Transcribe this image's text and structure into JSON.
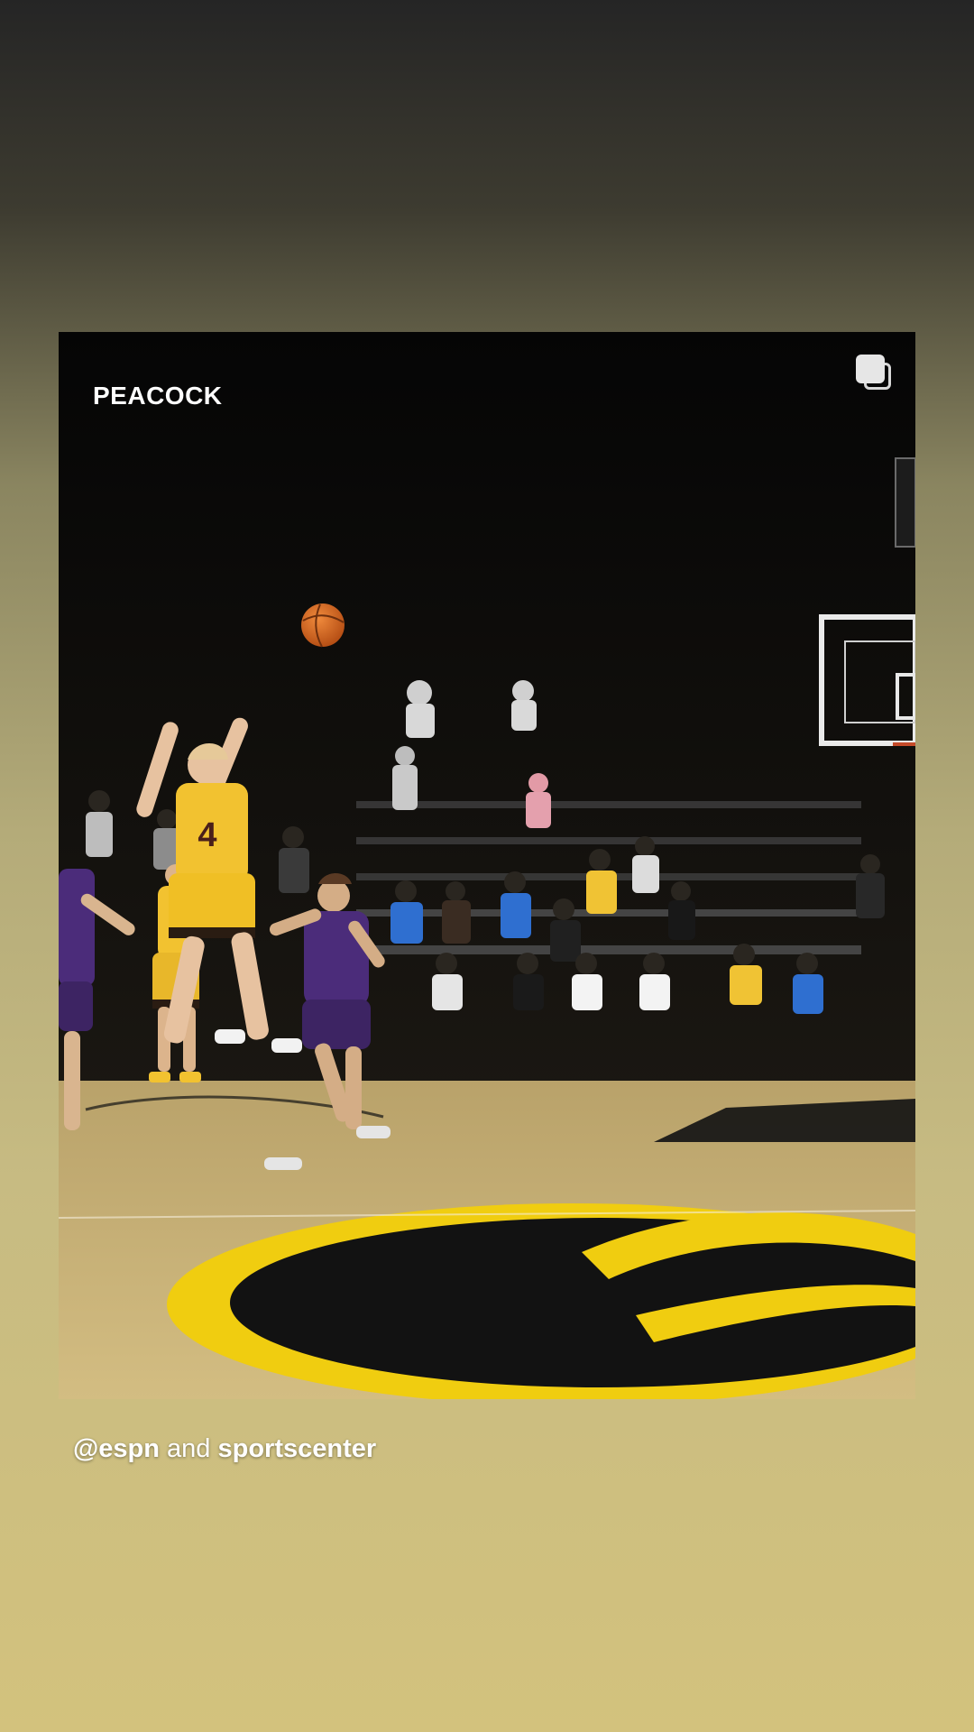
{
  "post": {
    "watermark": "PEACOCK",
    "overlay_icon": "multiple-media-icon",
    "scene_description_icon": "basketball-jump-shot-image"
  },
  "caption": {
    "mention_1": "@espn",
    "joiner": "and",
    "mention_2": "sportscenter"
  },
  "player": {
    "jersey_number": "4"
  },
  "colors": {
    "jersey_gold": "#f2c230",
    "opponent_purple": "#4b2c7a",
    "court_wood": "#cdb67a",
    "logo_black": "#121212"
  }
}
